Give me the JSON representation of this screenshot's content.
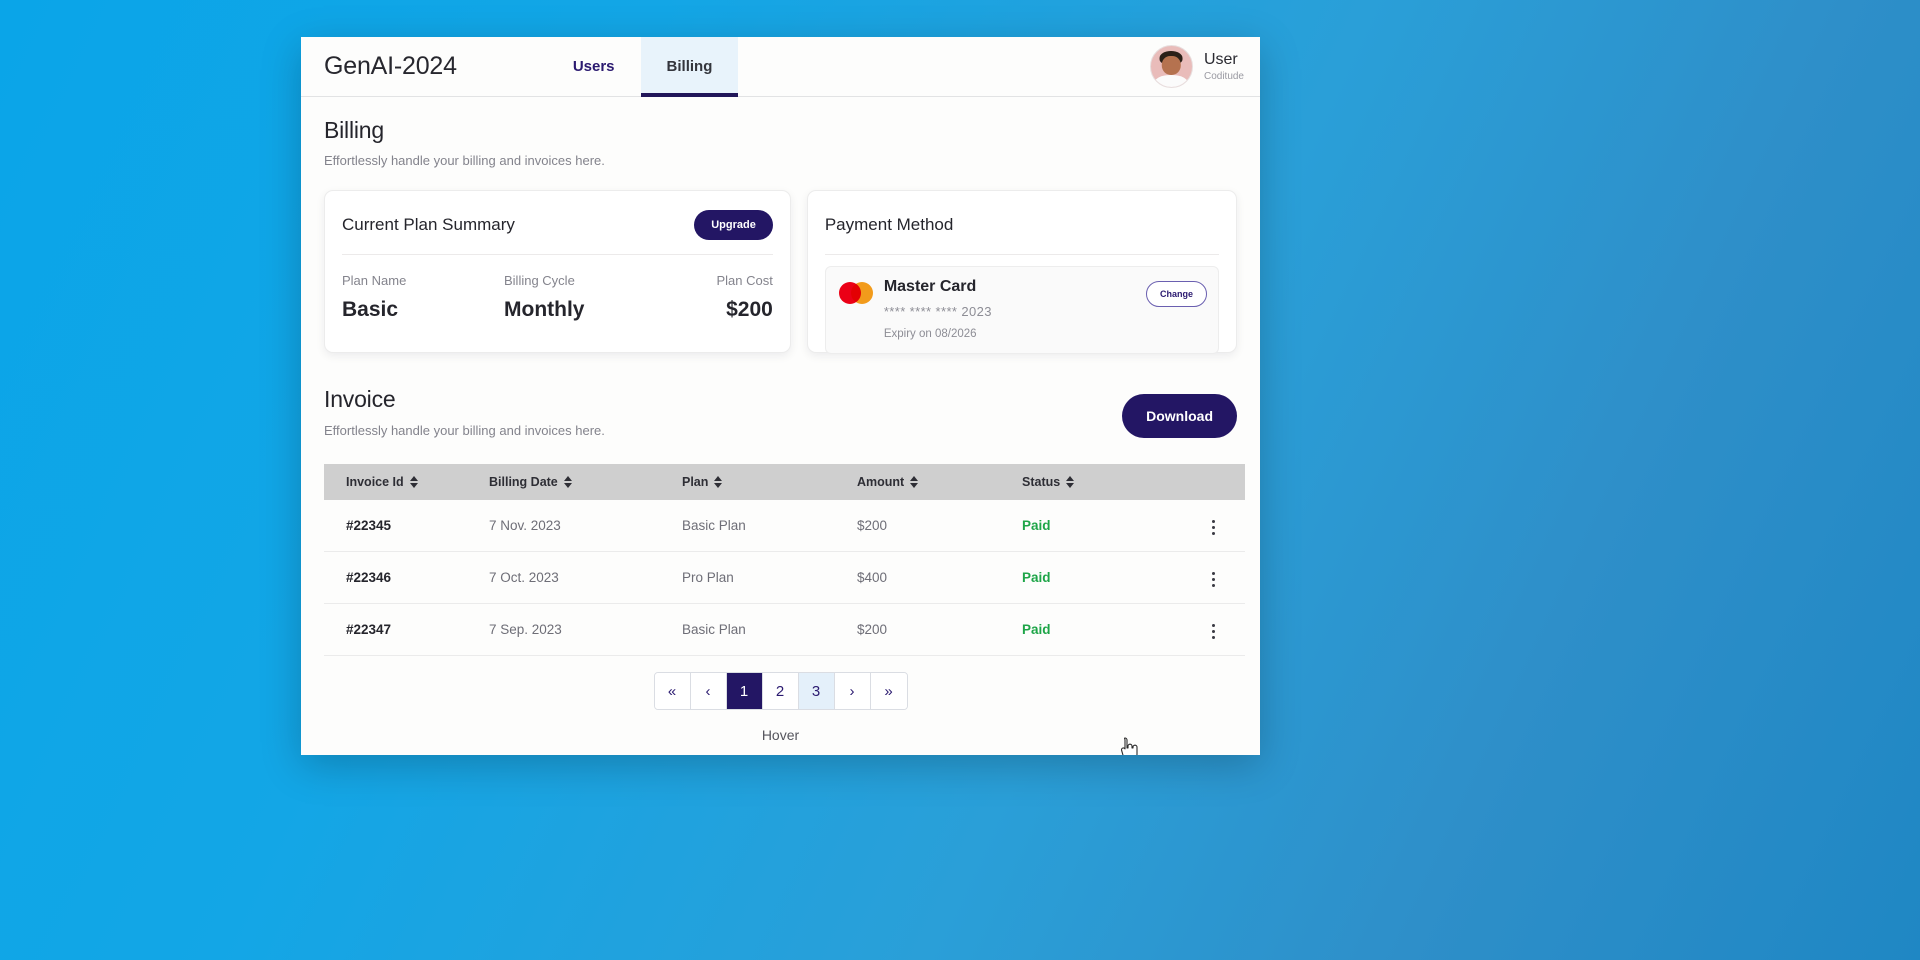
{
  "brand": "GenAI-2024",
  "nav": {
    "tabs": [
      {
        "label": "Users",
        "active": false
      },
      {
        "label": "Billing",
        "active": true
      }
    ]
  },
  "profile": {
    "name": "User",
    "org": "Coditude",
    "avatar_icon": "user-avatar-photo"
  },
  "page": {
    "title": "Billing",
    "subtitle": "Effortlessly handle your billing and invoices here."
  },
  "plan_card": {
    "title": "Current Plan Summary",
    "upgrade_label": "Upgrade",
    "fields": [
      {
        "label": "Plan Name",
        "value": "Basic"
      },
      {
        "label": "Billing Cycle",
        "value": "Monthly"
      },
      {
        "label": "Plan Cost",
        "value": "$200"
      }
    ]
  },
  "payment_card": {
    "title": "Payment Method",
    "card_brand": "Master Card",
    "card_number": "**** **** **** 2023",
    "expiry": "Expiry on 08/2026",
    "change_label": "Change",
    "brand_icon": "mastercard-icon",
    "colors": {
      "mc_red": "#eb0016",
      "mc_yellow": "#f79e1b"
    }
  },
  "invoice": {
    "title": "Invoice",
    "subtitle": "Effortlessly handle your billing and invoices here.",
    "download_label": "Download",
    "columns": [
      "Invoice Id",
      "Billing Date",
      "Plan",
      "Amount",
      "Status"
    ],
    "rows": [
      {
        "id": "#22345",
        "date": "7 Nov. 2023",
        "plan": "Basic Plan",
        "amount": "$200",
        "status": "Paid"
      },
      {
        "id": "#22346",
        "date": "7 Oct. 2023",
        "plan": "Pro Plan",
        "amount": "$400",
        "status": "Paid"
      },
      {
        "id": "#22347",
        "date": "7 Sep. 2023",
        "plan": "Basic Plan",
        "amount": "$200",
        "status": "Paid"
      }
    ]
  },
  "pagination": {
    "items": [
      {
        "label": "«",
        "name": "first",
        "state": "normal"
      },
      {
        "label": "‹",
        "name": "prev",
        "state": "normal"
      },
      {
        "label": "1",
        "name": "page-1",
        "state": "active"
      },
      {
        "label": "2",
        "name": "page-2",
        "state": "normal"
      },
      {
        "label": "3",
        "name": "page-3",
        "state": "hovered"
      },
      {
        "label": "›",
        "name": "next",
        "state": "normal"
      },
      {
        "label": "»",
        "name": "last",
        "state": "normal"
      }
    ],
    "hover_label": "Hover"
  },
  "colors": {
    "primary": "#231664",
    "accent_blue": "#e8f3fb",
    "status_paid": "#1ea548",
    "table_header": "#cfcfcf",
    "background_gradient_from": "#0aa5e8",
    "background_gradient_to": "#1f87c4"
  }
}
